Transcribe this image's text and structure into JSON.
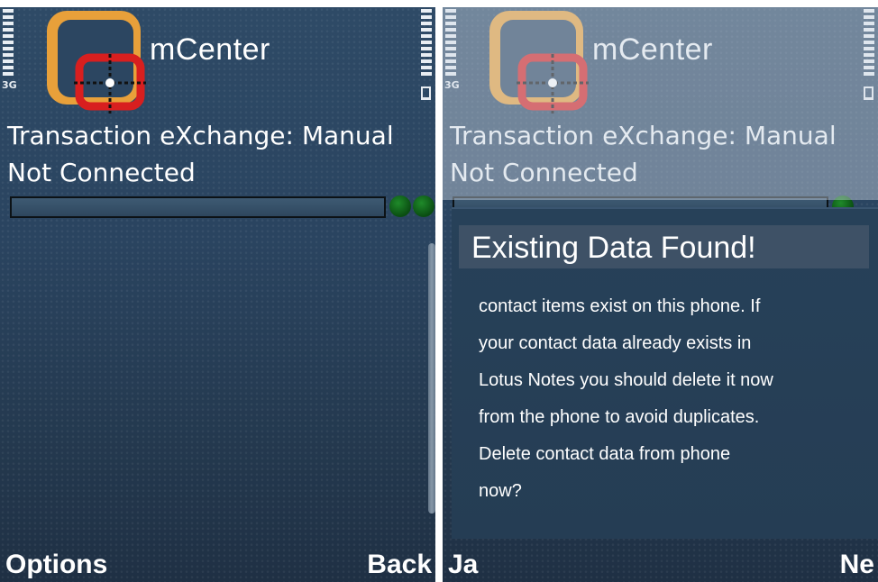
{
  "app": {
    "title": "mCenter",
    "network_label": "3G"
  },
  "status": {
    "exchange_line": "Transaction eXchange: Manual",
    "connection_line": "Not Connected"
  },
  "left_screen": {
    "softkey_left": "Options",
    "softkey_right": "Back"
  },
  "right_screen": {
    "dialog": {
      "title": "Existing Data Found!",
      "body_lines": [
        "contact items exist on this phone.  If",
        "your contact data already exists in",
        "Lotus Notes you should delete it now",
        "from the phone to avoid duplicates.",
        "Delete contact data from phone",
        "now?"
      ]
    },
    "softkey_left": "Ja",
    "softkey_right": "Ne"
  },
  "colors": {
    "background": "#2a4460",
    "logo_orange": "#e8a03a",
    "logo_red": "#d81f1f",
    "led_green": "#0f6a1b",
    "dialog_header": "#3e5166"
  },
  "icons": [
    "signal-bars-icon",
    "battery-bars-icon",
    "network-3g-icon",
    "battery-icon",
    "mcenter-logo-icon",
    "connection-led-icon"
  ]
}
